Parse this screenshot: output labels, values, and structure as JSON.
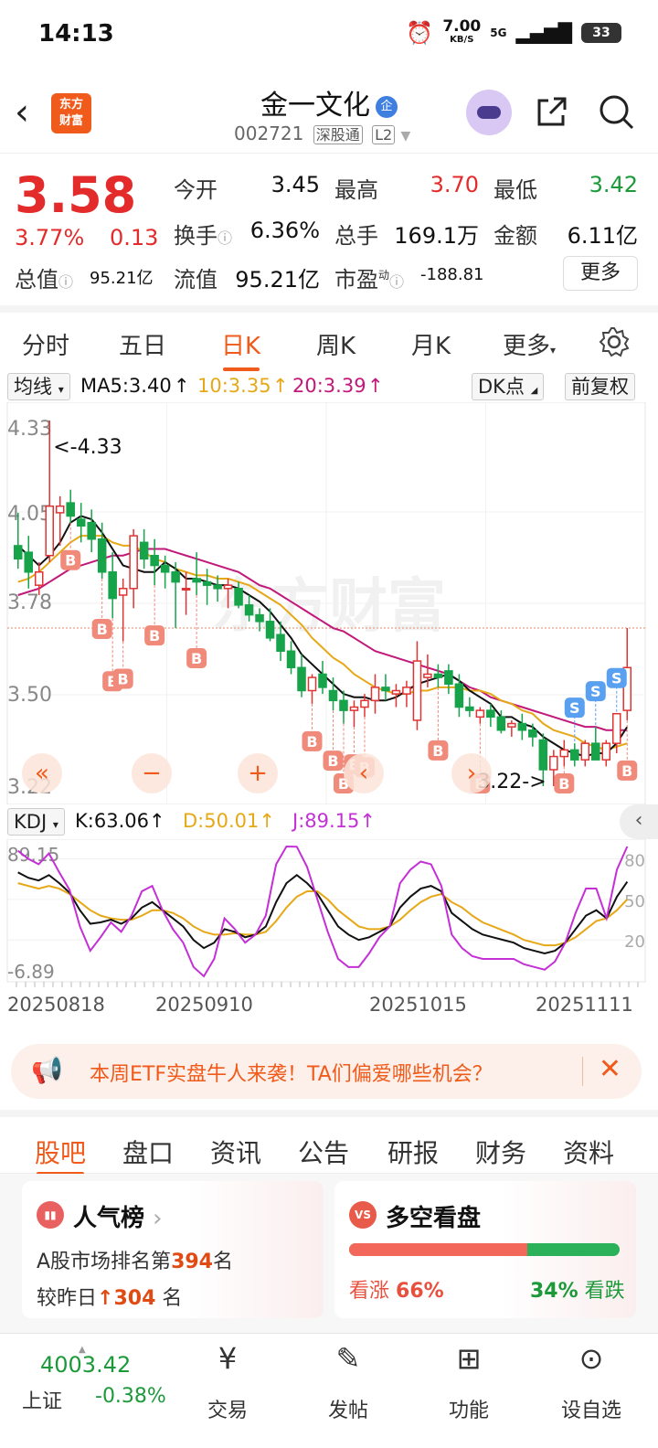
{
  "status": {
    "time": "14:13",
    "speed_value": "7.00",
    "speed_unit": "KB/S",
    "network": "5G",
    "battery": "33"
  },
  "header": {
    "logo_line1": "东方",
    "logo_line2": "财富",
    "stock_name": "金一文化",
    "badge": "企",
    "stock_code": "002721",
    "tag1": "深股通",
    "tag2": "L2"
  },
  "quote": {
    "price": "3.58",
    "change_pct": "3.77%",
    "change": "0.13",
    "rows": [
      [
        {
          "label": "今开",
          "value": "3.45",
          "color": "dark"
        },
        {
          "label": "最高",
          "value": "3.70",
          "color": "red"
        },
        {
          "label": "最低",
          "value": "3.42",
          "color": "green"
        }
      ],
      [
        {
          "label": "换手",
          "value": "6.36%",
          "color": "dark"
        },
        {
          "label": "总手",
          "value": "169.1万",
          "color": "dark"
        },
        {
          "label": "金额",
          "value": "6.11亿",
          "color": "dark"
        }
      ]
    ],
    "zongzhi_label": "总值",
    "zongzhi_value": "95.21亿",
    "liuzhi_label": "流值",
    "liuzhi_value": "95.21亿",
    "shiying_label": "市盈",
    "shiying_sup": "动",
    "shiying_value": "-188.81",
    "more_button": "更多"
  },
  "kline_tabs": [
    "分时",
    "五日",
    "日K",
    "周K",
    "月K",
    "更多"
  ],
  "kline_active_tab": "日K",
  "ma": {
    "toggle": "均线",
    "ma5": "MA5:3.40",
    "ma10": "10:3.35",
    "ma20": "20:3.39",
    "dk_button": "DK点",
    "fq_button": "前复权",
    "colors": {
      "ma5": "#111111",
      "ma10": "#e6a817",
      "ma20": "#c2187a"
    }
  },
  "chart_data": {
    "type": "candlestick",
    "price_axis_labels": [
      "4.33",
      "4.05",
      "3.78",
      "3.50",
      "3.22"
    ],
    "ylim": [
      3.22,
      4.33
    ],
    "high_marker": "<-4.33",
    "low_marker": "3.22->",
    "date_labels": [
      "20250818",
      "20250910",
      "20251015",
      "20251111"
    ],
    "candles": [
      {
        "o": 3.95,
        "h": 4.05,
        "l": 3.88,
        "c": 3.91
      },
      {
        "o": 3.93,
        "h": 3.98,
        "l": 3.82,
        "c": 3.87
      },
      {
        "o": 3.83,
        "h": 3.9,
        "l": 3.8,
        "c": 3.87
      },
      {
        "o": 3.92,
        "h": 4.33,
        "l": 3.9,
        "c": 4.07
      },
      {
        "o": 4.05,
        "h": 4.1,
        "l": 3.95,
        "c": 4.07
      },
      {
        "o": 4.08,
        "h": 4.12,
        "l": 4.02,
        "c": 4.04
      },
      {
        "o": 4.03,
        "h": 4.08,
        "l": 3.96,
        "c": 4.01
      },
      {
        "o": 4.02,
        "h": 4.06,
        "l": 3.93,
        "c": 3.97
      },
      {
        "o": 3.97,
        "h": 4.02,
        "l": 3.85,
        "c": 3.87
      },
      {
        "o": 3.87,
        "h": 3.93,
        "l": 3.73,
        "c": 3.79
      },
      {
        "o": 3.8,
        "h": 3.85,
        "l": 3.66,
        "c": 3.82
      },
      {
        "o": 3.82,
        "h": 4.0,
        "l": 3.76,
        "c": 3.98
      },
      {
        "o": 3.96,
        "h": 4.0,
        "l": 3.88,
        "c": 3.91
      },
      {
        "o": 3.92,
        "h": 3.97,
        "l": 3.83,
        "c": 3.89
      },
      {
        "o": 3.89,
        "h": 3.92,
        "l": 3.82,
        "c": 3.87
      },
      {
        "o": 3.87,
        "h": 3.9,
        "l": 3.7,
        "c": 3.84
      },
      {
        "o": 3.82,
        "h": 3.87,
        "l": 3.74,
        "c": 3.82
      },
      {
        "o": 3.85,
        "h": 3.93,
        "l": 3.8,
        "c": 3.84
      },
      {
        "o": 3.84,
        "h": 3.88,
        "l": 3.77,
        "c": 3.83
      },
      {
        "o": 3.83,
        "h": 3.86,
        "l": 3.78,
        "c": 3.82
      },
      {
        "o": 3.82,
        "h": 3.85,
        "l": 3.76,
        "c": 3.83
      },
      {
        "o": 3.82,
        "h": 3.84,
        "l": 3.76,
        "c": 3.77
      },
      {
        "o": 3.77,
        "h": 3.8,
        "l": 3.72,
        "c": 3.74
      },
      {
        "o": 3.74,
        "h": 3.76,
        "l": 3.69,
        "c": 3.72
      },
      {
        "o": 3.72,
        "h": 3.76,
        "l": 3.66,
        "c": 3.67
      },
      {
        "o": 3.68,
        "h": 3.72,
        "l": 3.6,
        "c": 3.63
      },
      {
        "o": 3.63,
        "h": 3.66,
        "l": 3.56,
        "c": 3.58
      },
      {
        "o": 3.58,
        "h": 3.62,
        "l": 3.49,
        "c": 3.51
      },
      {
        "o": 3.51,
        "h": 3.56,
        "l": 3.47,
        "c": 3.55
      },
      {
        "o": 3.56,
        "h": 3.6,
        "l": 3.5,
        "c": 3.52
      },
      {
        "o": 3.51,
        "h": 3.55,
        "l": 3.45,
        "c": 3.48
      },
      {
        "o": 3.48,
        "h": 3.51,
        "l": 3.41,
        "c": 3.45
      },
      {
        "o": 3.45,
        "h": 3.48,
        "l": 3.4,
        "c": 3.46
      },
      {
        "o": 3.46,
        "h": 3.5,
        "l": 3.43,
        "c": 3.48
      },
      {
        "o": 3.48,
        "h": 3.56,
        "l": 3.44,
        "c": 3.52
      },
      {
        "o": 3.52,
        "h": 3.56,
        "l": 3.48,
        "c": 3.51
      },
      {
        "o": 3.5,
        "h": 3.53,
        "l": 3.46,
        "c": 3.51
      },
      {
        "o": 3.5,
        "h": 3.54,
        "l": 3.46,
        "c": 3.52
      },
      {
        "o": 3.42,
        "h": 3.66,
        "l": 3.39,
        "c": 3.6
      },
      {
        "o": 3.55,
        "h": 3.62,
        "l": 3.52,
        "c": 3.56
      },
      {
        "o": 3.56,
        "h": 3.59,
        "l": 3.52,
        "c": 3.55
      },
      {
        "o": 3.57,
        "h": 3.59,
        "l": 3.5,
        "c": 3.53
      },
      {
        "o": 3.53,
        "h": 3.56,
        "l": 3.43,
        "c": 3.46
      },
      {
        "o": 3.46,
        "h": 3.49,
        "l": 3.43,
        "c": 3.45
      },
      {
        "o": 3.43,
        "h": 3.46,
        "l": 3.41,
        "c": 3.45
      },
      {
        "o": 3.45,
        "h": 3.47,
        "l": 3.4,
        "c": 3.43
      },
      {
        "o": 3.43,
        "h": 3.45,
        "l": 3.38,
        "c": 3.39
      },
      {
        "o": 3.4,
        "h": 3.42,
        "l": 3.37,
        "c": 3.41
      },
      {
        "o": 3.41,
        "h": 3.44,
        "l": 3.36,
        "c": 3.39
      },
      {
        "o": 3.39,
        "h": 3.41,
        "l": 3.34,
        "c": 3.37
      },
      {
        "o": 3.36,
        "h": 3.38,
        "l": 3.22,
        "c": 3.27
      },
      {
        "o": 3.27,
        "h": 3.33,
        "l": 3.22,
        "c": 3.31
      },
      {
        "o": 3.31,
        "h": 3.36,
        "l": 3.28,
        "c": 3.33
      },
      {
        "o": 3.33,
        "h": 3.35,
        "l": 3.28,
        "c": 3.3
      },
      {
        "o": 3.3,
        "h": 3.36,
        "l": 3.28,
        "c": 3.35
      },
      {
        "o": 3.35,
        "h": 3.4,
        "l": 3.32,
        "c": 3.3
      },
      {
        "o": 3.3,
        "h": 3.36,
        "l": 3.28,
        "c": 3.35
      },
      {
        "o": 3.35,
        "h": 3.44,
        "l": 3.32,
        "c": 3.44
      },
      {
        "o": 3.45,
        "h": 3.7,
        "l": 3.42,
        "c": 3.58
      }
    ],
    "ma5": [
      3.95,
      3.92,
      3.89,
      3.92,
      3.96,
      4.02,
      4.04,
      4.03,
      3.99,
      3.94,
      3.89,
      3.88,
      3.87,
      3.87,
      3.9,
      3.88,
      3.85,
      3.85,
      3.84,
      3.83,
      3.83,
      3.82,
      3.8,
      3.78,
      3.75,
      3.71,
      3.67,
      3.62,
      3.59,
      3.56,
      3.53,
      3.5,
      3.49,
      3.49,
      3.48,
      3.48,
      3.49,
      3.51,
      3.53,
      3.54,
      3.55,
      3.56,
      3.54,
      3.51,
      3.49,
      3.47,
      3.43,
      3.43,
      3.41,
      3.4,
      3.37,
      3.35,
      3.33,
      3.32,
      3.31,
      3.32,
      3.32,
      3.35,
      3.4
    ],
    "ma10": [
      3.84,
      3.85,
      3.87,
      3.9,
      3.93,
      3.96,
      3.98,
      3.98,
      3.98,
      3.96,
      3.95,
      3.95,
      3.93,
      3.91,
      3.9,
      3.88,
      3.87,
      3.86,
      3.86,
      3.85,
      3.85,
      3.84,
      3.83,
      3.81,
      3.79,
      3.77,
      3.74,
      3.71,
      3.67,
      3.64,
      3.61,
      3.59,
      3.56,
      3.54,
      3.52,
      3.51,
      3.5,
      3.5,
      3.51,
      3.51,
      3.52,
      3.52,
      3.52,
      3.51,
      3.51,
      3.5,
      3.48,
      3.47,
      3.45,
      3.44,
      3.41,
      3.39,
      3.38,
      3.37,
      3.35,
      3.34,
      3.33,
      3.34,
      3.35
    ],
    "ma20": [
      3.8,
      3.81,
      3.82,
      3.84,
      3.86,
      3.88,
      3.89,
      3.9,
      3.91,
      3.92,
      3.92,
      3.93,
      3.94,
      3.94,
      3.94,
      3.93,
      3.92,
      3.91,
      3.9,
      3.89,
      3.88,
      3.87,
      3.85,
      3.83,
      3.82,
      3.8,
      3.78,
      3.76,
      3.74,
      3.72,
      3.7,
      3.69,
      3.67,
      3.65,
      3.63,
      3.62,
      3.61,
      3.6,
      3.59,
      3.58,
      3.57,
      3.56,
      3.54,
      3.52,
      3.51,
      3.49,
      3.48,
      3.47,
      3.46,
      3.45,
      3.44,
      3.43,
      3.42,
      3.41,
      3.4,
      3.4,
      3.39,
      3.39,
      3.39
    ],
    "signals": [
      {
        "i": 5,
        "type": "B"
      },
      {
        "i": 8,
        "type": "B"
      },
      {
        "i": 9,
        "type": "B"
      },
      {
        "i": 10,
        "type": "B"
      },
      {
        "i": 13,
        "type": "B"
      },
      {
        "i": 17,
        "type": "B"
      },
      {
        "i": 28,
        "type": "B"
      },
      {
        "i": 30,
        "type": "B"
      },
      {
        "i": 31,
        "type": "B"
      },
      {
        "i": 32,
        "type": "B"
      },
      {
        "i": 33,
        "type": "B"
      },
      {
        "i": 44,
        "type": "B"
      },
      {
        "i": 52,
        "type": "B"
      },
      {
        "i": 58,
        "type": "B"
      },
      {
        "i": 53,
        "type": "S"
      },
      {
        "i": 55,
        "type": "S"
      },
      {
        "i": 57,
        "type": "S"
      },
      {
        "i": 40,
        "type": "B"
      }
    ],
    "kdj": {
      "toggle": "KDJ",
      "k_label": "K:63.06",
      "d_label": "D:50.01",
      "j_label": "J:89.15",
      "max_label": "89.15",
      "min_label": "-6.89",
      "ylim": [
        -6.89,
        89.15
      ],
      "ref_labels": [
        "80",
        "50",
        "20"
      ],
      "k": [
        70,
        66,
        64,
        68,
        62,
        55,
        42,
        32,
        33,
        35,
        32,
        36,
        44,
        48,
        42,
        36,
        30,
        20,
        14,
        18,
        28,
        26,
        22,
        24,
        30,
        48,
        62,
        68,
        62,
        54,
        42,
        30,
        24,
        20,
        22,
        26,
        30,
        44,
        52,
        58,
        60,
        56,
        40,
        34,
        28,
        24,
        22,
        20,
        18,
        14,
        12,
        10,
        12,
        18,
        28,
        38,
        42,
        36,
        52,
        63.06
      ],
      "d": [
        62,
        60,
        58,
        60,
        58,
        54,
        48,
        42,
        38,
        36,
        35,
        35,
        38,
        42,
        42,
        40,
        36,
        30,
        26,
        24,
        24,
        25,
        24,
        24,
        26,
        34,
        44,
        52,
        56,
        56,
        50,
        42,
        36,
        30,
        28,
        28,
        30,
        35,
        42,
        48,
        52,
        54,
        48,
        44,
        38,
        33,
        30,
        27,
        24,
        20,
        18,
        16,
        16,
        18,
        22,
        28,
        34,
        36,
        42,
        50.01
      ],
      "j": [
        86,
        80,
        76,
        84,
        70,
        57,
        30,
        12,
        22,
        33,
        26,
        38,
        56,
        60,
        42,
        28,
        18,
        0,
        -6.89,
        6,
        36,
        28,
        18,
        24,
        38,
        76,
        89.15,
        89,
        74,
        50,
        26,
        6,
        0,
        0,
        10,
        22,
        30,
        62,
        72,
        78,
        76,
        60,
        24,
        14,
        8,
        6,
        6,
        6,
        6,
        2,
        0,
        -2,
        4,
        18,
        40,
        58,
        58,
        36,
        72,
        89.15
      ]
    }
  },
  "banner": {
    "text": "本周ETF实盘牛人来袭！TA们偏爱哪些机会？"
  },
  "bottom_tabs": [
    "股吧",
    "盘口",
    "资讯",
    "公告",
    "研报",
    "财务",
    "资料"
  ],
  "bottom_active_tab": "股吧",
  "popularity": {
    "title": "人气榜",
    "line1_prefix": "A股市场排名第",
    "rank": "394",
    "line1_suffix": "名",
    "line2_prefix": "较昨日",
    "change": "304",
    "line2_suffix": "名"
  },
  "bullbear": {
    "title": "多空看盘",
    "bull_label": "看涨",
    "bull_pct": "66%",
    "bull_value": 0.66,
    "bear_pct": "34%",
    "bear_label": "看跌"
  },
  "nav": {
    "index_value": "4003.42",
    "index_name": "上证",
    "index_change": "-0.38%",
    "items": [
      "交易",
      "发帖",
      "功能",
      "设自选"
    ]
  },
  "watermark": "东方财富"
}
